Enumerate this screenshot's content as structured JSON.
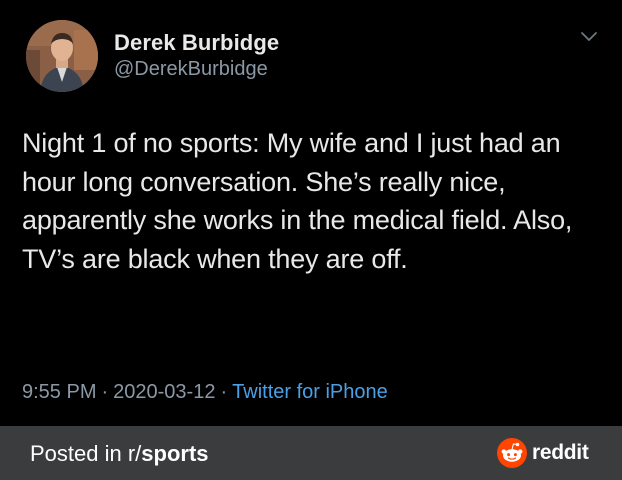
{
  "tweet": {
    "author_name": "Derek Burbidge",
    "author_handle": "@DerekBurbidge",
    "text": "Night 1 of no sports: My wife and I just had an hour long conversation. She’s really nice, apparently she works in the medical field. Also, TV’s are black when they are off.",
    "time": "9:55 PM",
    "separator": "·",
    "date": "2020-03-12",
    "source": "Twitter for iPhone",
    "menu_icon": "chevron-down-icon",
    "avatar_icon": "avatar"
  },
  "footer": {
    "posted_prefix": "Posted in r/",
    "subreddit": "sports",
    "brand": "reddit",
    "brand_icon": "reddit-snoo-icon"
  },
  "colors": {
    "background": "#000000",
    "primary_text": "#e8e8e8",
    "secondary_text": "#8b98a5",
    "link": "#4aa0e6",
    "footer_bg": "#3b3c3e",
    "reddit_orange": "#ff4500"
  }
}
